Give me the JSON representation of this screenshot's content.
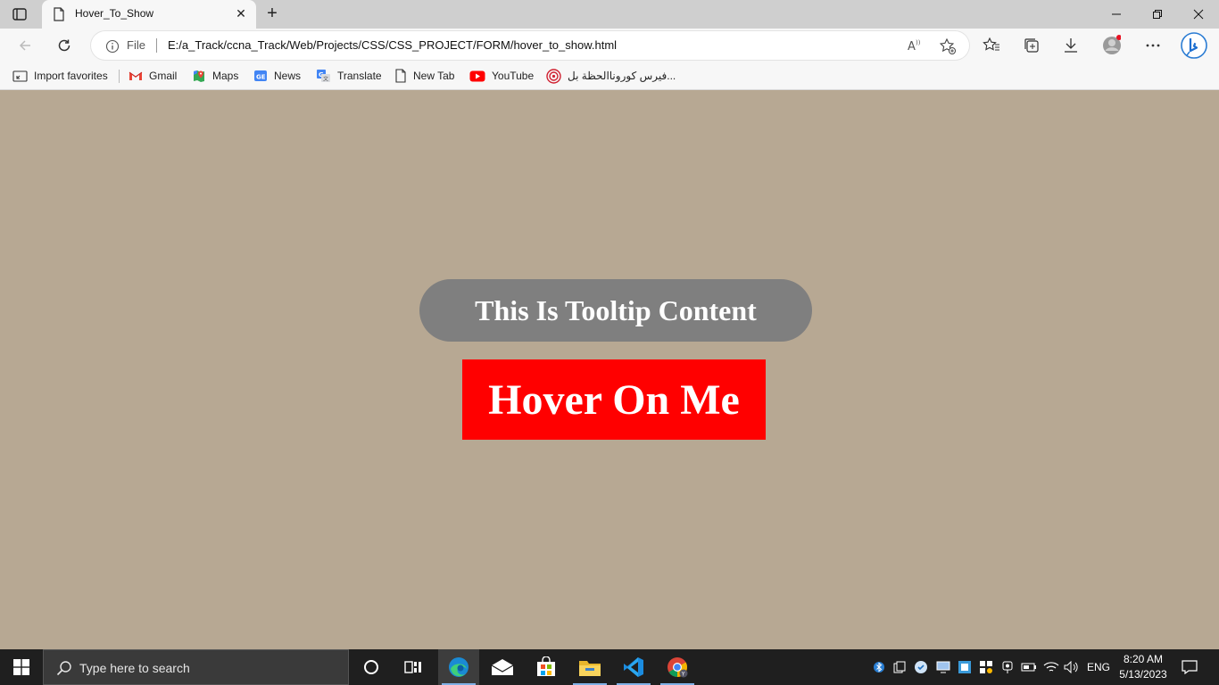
{
  "browser": {
    "tab": {
      "title": "Hover_To_Show"
    },
    "address": {
      "scheme_label": "File",
      "url": "E:/a_Track/ccna_Track/Web/Projects/CSS/CSS_PROJECT/FORM/hover_to_show.html"
    },
    "favorites": [
      {
        "label": "Import favorites",
        "icon": "import-icon"
      },
      {
        "label": "Gmail",
        "icon": "gmail-icon"
      },
      {
        "label": "Maps",
        "icon": "maps-icon"
      },
      {
        "label": "News",
        "icon": "news-icon"
      },
      {
        "label": "Translate",
        "icon": "translate-icon"
      },
      {
        "label": "New Tab",
        "icon": "page-icon"
      },
      {
        "label": "YouTube",
        "icon": "youtube-icon"
      },
      {
        "label": "فيرس كوروناالحظة بل...",
        "icon": "target-icon"
      }
    ]
  },
  "page": {
    "background": "#b7a893",
    "tooltip_text": "This Is Tooltip Content",
    "tooltip_color": "#7f7f7f",
    "button_text": "Hover On Me",
    "button_color": "#ff0000"
  },
  "taskbar": {
    "search_placeholder": "Type here to search",
    "language": "ENG",
    "time": "8:20 AM",
    "date": "5/13/2023"
  }
}
